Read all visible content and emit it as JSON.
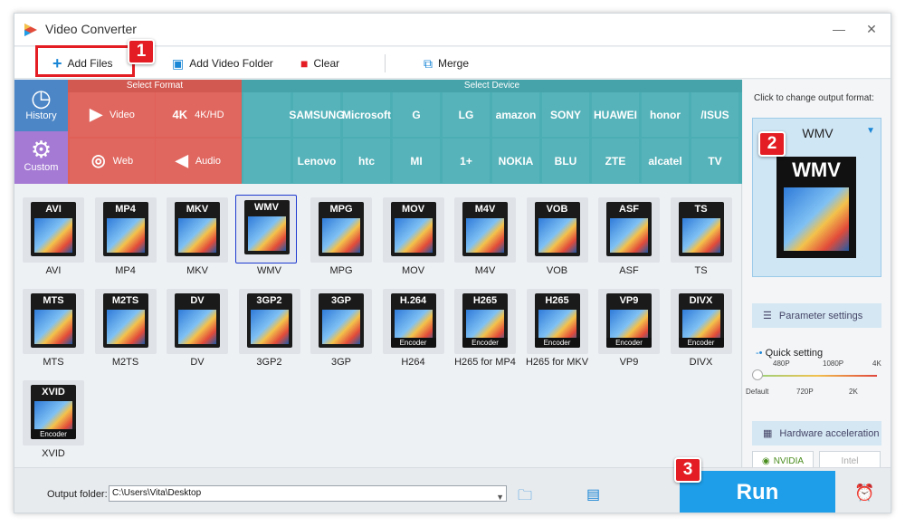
{
  "window": {
    "title": "Video Converter",
    "minimize": "—",
    "close": "✕"
  },
  "toolbar": {
    "add_files": "Add Files",
    "add_folder": "Add Video Folder",
    "clear": "Clear",
    "merge": "Merge"
  },
  "badges": [
    "1",
    "2",
    "3"
  ],
  "sidebar": {
    "history": "History",
    "custom": "Custom"
  },
  "format_group": {
    "header": "Select Format",
    "items": [
      "Video",
      "4K/HD",
      "Web",
      "Audio"
    ]
  },
  "device_group": {
    "header": "Select Device",
    "row1": [
      "",
      "SAMSUNG",
      "Microsoft",
      "G",
      "LG",
      "amazon",
      "SONY",
      "HUAWEI",
      "honor",
      "/ISUS"
    ],
    "row2": [
      "",
      "Lenovo",
      "htc",
      "MI",
      "1+",
      "NOKIA",
      "BLU",
      "ZTE",
      "alcatel",
      "TV"
    ]
  },
  "formats": [
    {
      "label": "AVI",
      "name": "AVI",
      "enc": ""
    },
    {
      "label": "MP4",
      "name": "MP4",
      "enc": ""
    },
    {
      "label": "MKV",
      "name": "MKV",
      "enc": ""
    },
    {
      "label": "WMV",
      "name": "WMV",
      "enc": ""
    },
    {
      "label": "MPG",
      "name": "MPG",
      "enc": ""
    },
    {
      "label": "MOV",
      "name": "MOV",
      "enc": ""
    },
    {
      "label": "M4V",
      "name": "M4V",
      "enc": ""
    },
    {
      "label": "VOB",
      "name": "VOB",
      "enc": ""
    },
    {
      "label": "ASF",
      "name": "ASF",
      "enc": ""
    },
    {
      "label": "TS",
      "name": "TS",
      "enc": ""
    },
    {
      "label": "MTS",
      "name": "MTS",
      "enc": ""
    },
    {
      "label": "M2TS",
      "name": "M2TS",
      "enc": ""
    },
    {
      "label": "DV",
      "name": "DV",
      "enc": ""
    },
    {
      "label": "3GP2",
      "name": "3GP2",
      "enc": ""
    },
    {
      "label": "3GP",
      "name": "3GP",
      "enc": ""
    },
    {
      "label": "H.264",
      "name": "H264",
      "enc": "Encoder"
    },
    {
      "label": "H265",
      "name": "H265 for MP4",
      "enc": "Encoder"
    },
    {
      "label": "H265",
      "name": "H265 for MKV",
      "enc": "Encoder"
    },
    {
      "label": "VP9",
      "name": "VP9",
      "enc": "Encoder"
    },
    {
      "label": "DIVX",
      "name": "DIVX",
      "enc": "Encoder"
    },
    {
      "label": "XVID",
      "name": "XVID",
      "enc": "Encoder"
    }
  ],
  "selected_format_index": 3,
  "right_panel": {
    "title": "Click to change output format:",
    "output_format": "WMV",
    "param_settings": "Parameter settings",
    "quick_setting": "Quick setting",
    "slider_top": [
      "480P",
      "1080P",
      "4K"
    ],
    "slider_bottom": [
      "Default",
      "720P",
      "2K"
    ],
    "hw_accel": "Hardware acceleration",
    "nvidia": "NVIDIA",
    "intel": "Intel"
  },
  "bottom": {
    "output_label": "Output folder:",
    "output_path": "C:\\Users\\Vita\\Desktop",
    "run": "Run"
  },
  "colors": {
    "accent": "#1e9ee8",
    "format_group": "#e05f57",
    "device_group": "#4caeb5",
    "badge": "#e31d23",
    "history": "#4c86c6",
    "custom": "#a57ad4"
  }
}
